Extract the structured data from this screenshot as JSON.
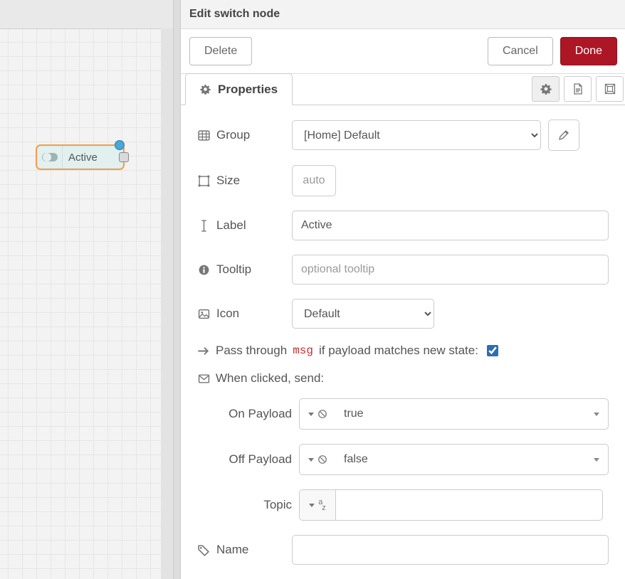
{
  "canvas": {
    "node_label": "Active"
  },
  "header": {
    "title": "Edit switch node"
  },
  "toolbar": {
    "delete": "Delete",
    "cancel": "Cancel",
    "done": "Done"
  },
  "tabs": {
    "properties": "Properties"
  },
  "form": {
    "group": {
      "label": "Group",
      "value": "[Home] Default"
    },
    "size": {
      "label": "Size",
      "value": "auto"
    },
    "label_field": {
      "label": "Label",
      "value": "Active"
    },
    "tooltip": {
      "label": "Tooltip",
      "placeholder": "optional tooltip",
      "value": ""
    },
    "icon": {
      "label": "Icon",
      "value": "Default"
    },
    "passthrough": {
      "pre": "Pass through",
      "code": "msg",
      "post": "if payload matches new state:",
      "checked": true
    },
    "when_clicked": "When clicked, send:",
    "on_payload": {
      "label": "On Payload",
      "value": "true"
    },
    "off_payload": {
      "label": "Off Payload",
      "value": "false"
    },
    "topic": {
      "label": "Topic",
      "value": ""
    },
    "name": {
      "label": "Name",
      "value": ""
    }
  }
}
